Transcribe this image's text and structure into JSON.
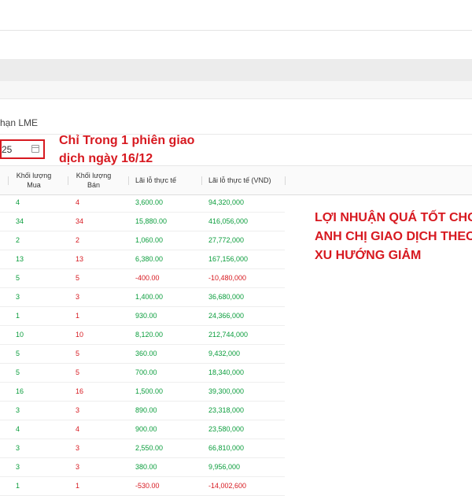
{
  "filter": {
    "commodity_label": "hạn LME",
    "date_partial": "25"
  },
  "annotations": {
    "session_note_line1": "Chỉ Trong 1 phiên giao",
    "session_note_line2": "dịch ngày 16/12",
    "profit_note_line1": "LỢI NHUẬN QUÁ TỐT CHO",
    "profit_note_line2": "ANH CHỊ GIAO DỊCH THEO",
    "profit_note_line3": "XU HƯỚNG GIẢM"
  },
  "table": {
    "headers": {
      "buy_qty": [
        "Khối lượng",
        "Mua"
      ],
      "sell_qty": [
        "Khối lượng",
        "Bán"
      ],
      "realized_pl": "Lãi lỗ thực tế",
      "realized_pl_vnd": "Lãi lỗ thực tế (VND)"
    },
    "rows": [
      {
        "buy": "4",
        "sell": "4",
        "pl": "3,600.00",
        "vnd": "94,320,000",
        "sign": "pos"
      },
      {
        "buy": "34",
        "sell": "34",
        "pl": "15,880.00",
        "vnd": "416,056,000",
        "sign": "pos"
      },
      {
        "buy": "2",
        "sell": "2",
        "pl": "1,060.00",
        "vnd": "27,772,000",
        "sign": "pos"
      },
      {
        "buy": "13",
        "sell": "13",
        "pl": "6,380.00",
        "vnd": "167,156,000",
        "sign": "pos"
      },
      {
        "buy": "5",
        "sell": "5",
        "pl": "-400.00",
        "vnd": "-10,480,000",
        "sign": "neg"
      },
      {
        "buy": "3",
        "sell": "3",
        "pl": "1,400.00",
        "vnd": "36,680,000",
        "sign": "pos"
      },
      {
        "buy": "1",
        "sell": "1",
        "pl": "930.00",
        "vnd": "24,366,000",
        "sign": "pos"
      },
      {
        "buy": "10",
        "sell": "10",
        "pl": "8,120.00",
        "vnd": "212,744,000",
        "sign": "pos"
      },
      {
        "buy": "5",
        "sell": "5",
        "pl": "360.00",
        "vnd": "9,432,000",
        "sign": "pos"
      },
      {
        "buy": "5",
        "sell": "5",
        "pl": "700.00",
        "vnd": "18,340,000",
        "sign": "pos"
      },
      {
        "buy": "16",
        "sell": "16",
        "pl": "1,500.00",
        "vnd": "39,300,000",
        "sign": "pos"
      },
      {
        "buy": "3",
        "sell": "3",
        "pl": "890.00",
        "vnd": "23,318,000",
        "sign": "pos"
      },
      {
        "buy": "4",
        "sell": "4",
        "pl": "900.00",
        "vnd": "23,580,000",
        "sign": "pos"
      },
      {
        "buy": "3",
        "sell": "3",
        "pl": "2,550.00",
        "vnd": "66,810,000",
        "sign": "pos"
      },
      {
        "buy": "3",
        "sell": "3",
        "pl": "380.00",
        "vnd": "9,956,000",
        "sign": "pos"
      },
      {
        "buy": "1",
        "sell": "1",
        "pl": "-530.00",
        "vnd": "-14,002,600",
        "sign": "neg"
      }
    ]
  },
  "icons": {
    "date_picker": "calendar-icon"
  },
  "colors": {
    "positive": "#0a9d3c",
    "negative": "#d71920",
    "highlight_border": "#d71920"
  }
}
